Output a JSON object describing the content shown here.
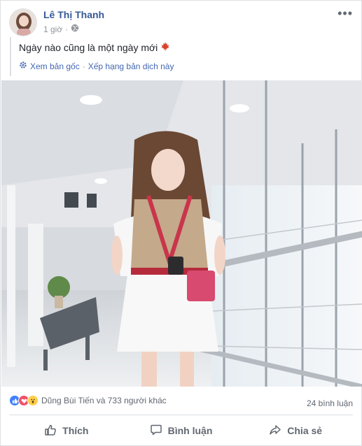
{
  "post": {
    "author": "Lê Thị Thanh",
    "time": "1 giờ",
    "dot": "·",
    "text": "Ngày nào cũng là một ngày mới",
    "more_label": "•••"
  },
  "translate": {
    "see_original": "Xem bản gốc",
    "separator": "·",
    "rate_translation": "Xếp hạng bản dịch này"
  },
  "reactions": {
    "summary": "Dũng Bùi Tiến và 733 người khác",
    "icons": [
      "like-icon",
      "love-icon",
      "wow-icon"
    ],
    "comments": "24 bình luận"
  },
  "actions": {
    "like": "Thích",
    "comment": "Bình luận",
    "share": "Chia sẻ"
  },
  "colors": {
    "link": "#365899",
    "accent": "#4267b2",
    "muted": "#606770"
  }
}
